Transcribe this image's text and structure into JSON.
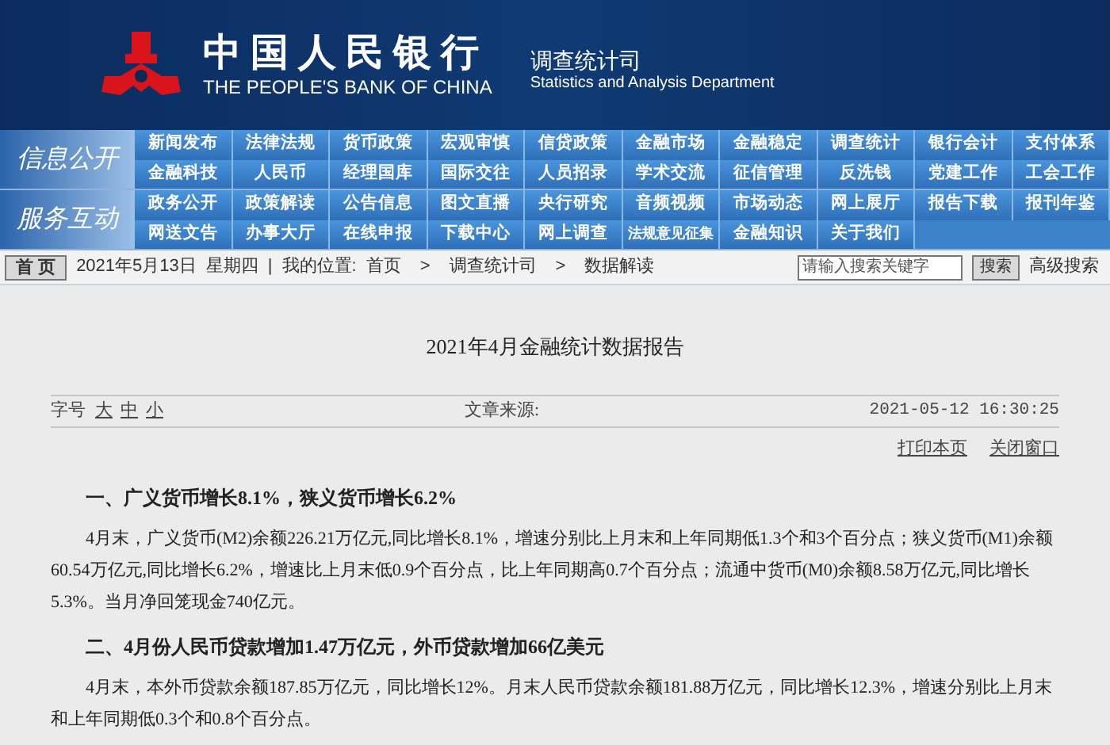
{
  "header": {
    "bank_name_cn": "中国人民银行",
    "bank_name_en": "THE PEOPLE'S BANK OF CHINA",
    "department_cn": "调查统计司",
    "department_en": "Statistics and Analysis Department"
  },
  "nav_groups": [
    {
      "label": "信息公开",
      "rows": [
        [
          "新闻发布",
          "法律法规",
          "货币政策",
          "宏观审慎",
          "信贷政策",
          "金融市场",
          "金融稳定",
          "调查统计",
          "银行会计",
          "支付体系"
        ],
        [
          "金融科技",
          "人民币",
          "经理国库",
          "国际交往",
          "人员招录",
          "学术交流",
          "征信管理",
          "反洗钱",
          "党建工作",
          "工会工作"
        ]
      ]
    },
    {
      "label": "服务互动",
      "rows": [
        [
          "政务公开",
          "政策解读",
          "公告信息",
          "图文直播",
          "央行研究",
          "音频视频",
          "市场动态",
          "网上展厅",
          "报告下载",
          "报刊年鉴"
        ],
        [
          "网送文告",
          "办事大厅",
          "在线申报",
          "下载中心",
          "网上调查",
          "法规意见征集",
          "金融知识",
          "关于我们"
        ]
      ]
    }
  ],
  "breadcrumb": {
    "home_button": "首 页",
    "date": "2021年5月13日",
    "weekday": "星期四",
    "separator": "|",
    "location_label": "我的位置:",
    "items": [
      "首页",
      "调查统计司",
      "数据解读"
    ],
    "arrow": ">",
    "search_placeholder": "请输入搜索关键字",
    "search_button": "搜索",
    "advanced_search": "高级搜索"
  },
  "article": {
    "title": "2021年4月金融统计数据报告",
    "font_size_label": "字号",
    "font_sizes": [
      "大",
      "中",
      "小"
    ],
    "source_label": "文章来源:",
    "datetime": "2021-05-12 16:30:25",
    "actions": [
      "打印本页",
      "关闭窗口"
    ],
    "blocks": [
      {
        "kind": "heading",
        "text": "一、广义货币增长8.1%，狭义货币增长6.2%"
      },
      {
        "kind": "paragraph",
        "text": "4月末，广义货币(M2)余额226.21万亿元,同比增长8.1%，增速分别比上月末和上年同期低1.3个和3个百分点；狭义货币(M1)余额60.54万亿元,同比增长6.2%，增速比上月末低0.9个百分点，比上年同期高0.7个百分点；流通中货币(M0)余额8.58万亿元,同比增长5.3%。当月净回笼现金740亿元。"
      },
      {
        "kind": "heading",
        "text": "二、4月份人民币贷款增加1.47万亿元，外币贷款增加66亿美元"
      },
      {
        "kind": "paragraph",
        "text": "4月末，本外币贷款余额187.85万亿元，同比增长12%。月末人民币贷款余额181.88万亿元，同比增长12.3%，增速分别比上月末和上年同期低0.3个和0.8个百分点。"
      }
    ]
  }
}
